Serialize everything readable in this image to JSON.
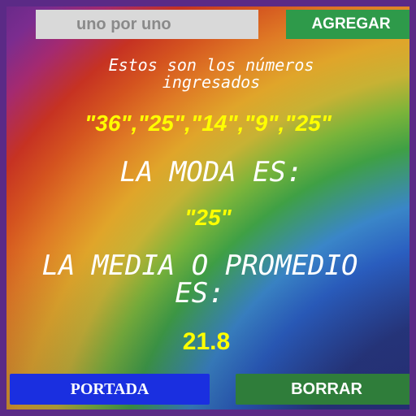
{
  "input": {
    "placeholder": "uno por uno",
    "value": ""
  },
  "buttons": {
    "add_label": "AGREGAR",
    "cover_label": "PORTADA",
    "clear_label": "BORRAR"
  },
  "results": {
    "intro_text": "Estos son los números ingresados",
    "numbers_text": "\"36\",\"25\",\"14\",\"9\",\"25\"",
    "mode_label": "LA MODA ES:",
    "mode_value": "\"25\"",
    "mean_label": "LA MEDIA O PROMEDIO ES:",
    "mean_value": "21.8"
  },
  "colors": {
    "frame": "#5b2a86",
    "add_button": "#2e9a4a",
    "cover_button": "#1a2fe0",
    "clear_button": "#2f7d3a",
    "highlight_text": "#ffff00",
    "label_text": "#ffffff"
  }
}
